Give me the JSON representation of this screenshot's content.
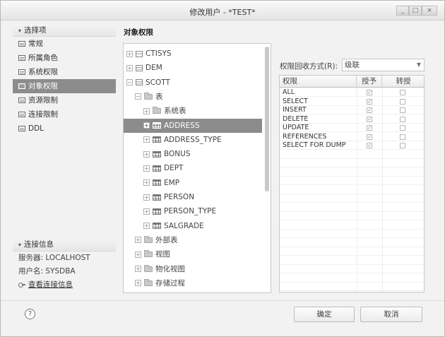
{
  "window": {
    "title": "修改用户 - *TEST*",
    "buttons": {
      "minimize": "_",
      "maximize": "□",
      "close": "×"
    }
  },
  "nav": {
    "header": "选择项",
    "items": [
      {
        "label": "常规",
        "icon": "form-icon",
        "selected": false
      },
      {
        "label": "所属角色",
        "icon": "form-icon",
        "selected": false
      },
      {
        "label": "系统权限",
        "icon": "form-icon",
        "selected": false
      },
      {
        "label": "对象权限",
        "icon": "form-icon",
        "selected": true
      },
      {
        "label": "资源限制",
        "icon": "form-icon",
        "selected": false
      },
      {
        "label": "连接限制",
        "icon": "form-icon",
        "selected": false
      },
      {
        "label": "DDL",
        "icon": "form-icon",
        "selected": false
      }
    ]
  },
  "connection": {
    "header": "连接信息",
    "server": "服务器: LOCALHOST",
    "user": "用户名: SYSDBA",
    "link": "查看连接信息"
  },
  "section_title": "对象权限",
  "tree": {
    "rows": [
      {
        "label": "CTISYS",
        "icon": "database-icon",
        "expander": "+",
        "depth": 0
      },
      {
        "label": "DEM",
        "icon": "database-icon",
        "expander": "+",
        "depth": 0
      },
      {
        "label": "SCOTT",
        "icon": "database-icon",
        "expander": "−",
        "depth": 0
      },
      {
        "label": "表",
        "icon": "folder-icon",
        "expander": "−",
        "depth": 1
      },
      {
        "label": "系统表",
        "icon": "folder-icon",
        "expander": "+",
        "depth": 2
      },
      {
        "label": "ADDRESS",
        "icon": "table-icon",
        "expander": "+",
        "depth": 2,
        "selected": true
      },
      {
        "label": "ADDRESS_TYPE",
        "icon": "table-icon",
        "expander": "+",
        "depth": 2
      },
      {
        "label": "BONUS",
        "icon": "table-icon",
        "expander": "+",
        "depth": 2
      },
      {
        "label": "DEPT",
        "icon": "table-icon",
        "expander": "+",
        "depth": 2
      },
      {
        "label": "EMP",
        "icon": "table-icon",
        "expander": "+",
        "depth": 2
      },
      {
        "label": "PERSON",
        "icon": "table-icon",
        "expander": "+",
        "depth": 2
      },
      {
        "label": "PERSON_TYPE",
        "icon": "table-icon",
        "expander": "+",
        "depth": 2
      },
      {
        "label": "SALGRADE",
        "icon": "table-icon",
        "expander": "+",
        "depth": 2
      },
      {
        "label": "外部表",
        "icon": "folder-icon",
        "expander": "+",
        "depth": 1
      },
      {
        "label": "视图",
        "icon": "folder-icon",
        "expander": "+",
        "depth": 1
      },
      {
        "label": "物化视图",
        "icon": "folder-icon",
        "expander": "+",
        "depth": 1
      },
      {
        "label": "存储过程",
        "icon": "folder-icon",
        "expander": "+",
        "depth": 1
      }
    ]
  },
  "revoke": {
    "label": "权限回收方式(R):",
    "value": "级联"
  },
  "grid": {
    "columns": [
      "权限",
      "授予",
      "转授"
    ],
    "rows": [
      {
        "name": "ALL",
        "grant": true,
        "transfer": false
      },
      {
        "name": "SELECT",
        "grant": true,
        "transfer": false
      },
      {
        "name": "INSERT",
        "grant": true,
        "transfer": false
      },
      {
        "name": "DELETE",
        "grant": true,
        "transfer": false
      },
      {
        "name": "UPDATE",
        "grant": true,
        "transfer": false
      },
      {
        "name": "REFERENCES",
        "grant": true,
        "transfer": false
      },
      {
        "name": "SELECT FOR DUMP",
        "grant": true,
        "transfer": false
      }
    ]
  },
  "footer": {
    "help": "?",
    "ok": "确定",
    "cancel": "取消"
  },
  "colors": {
    "selection": "#8c8c8c",
    "border": "#c6c6c6",
    "window_bg": "#f2f2f2"
  }
}
